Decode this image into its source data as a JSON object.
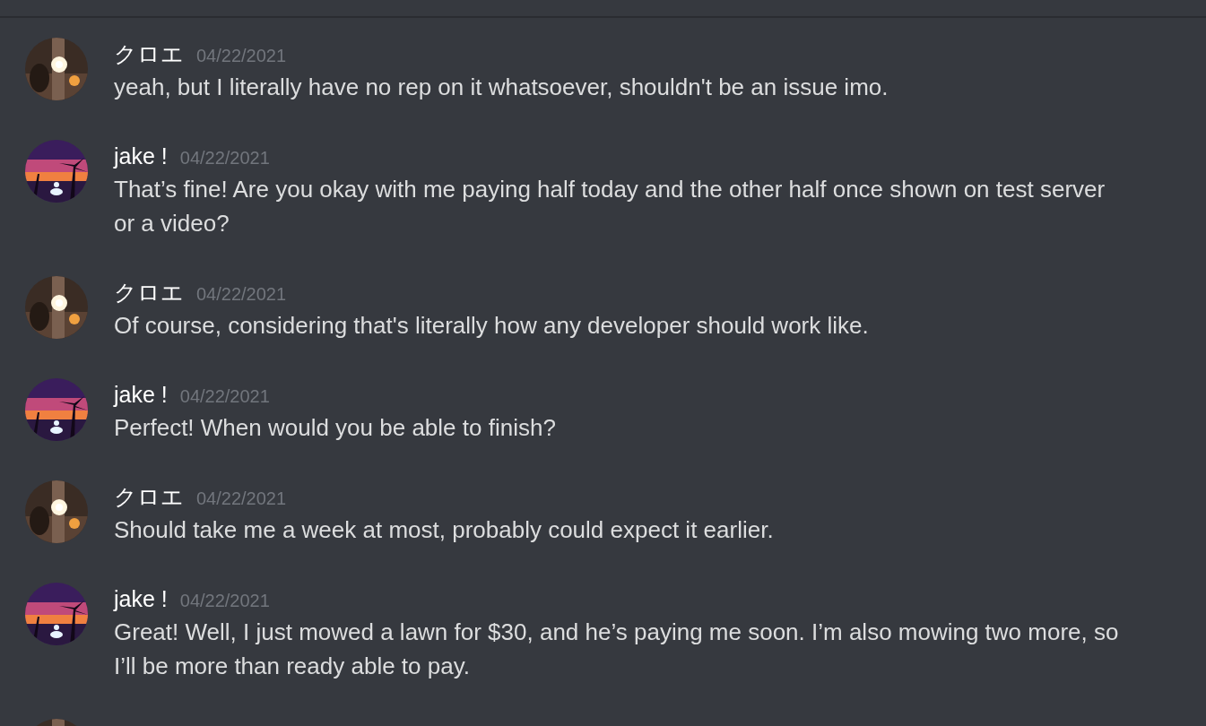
{
  "messages": [
    {
      "avatar": {
        "kind": "picture"
      },
      "author": "クロエ",
      "time": "04/22/2021",
      "text": "yeah, but I literally have no rep on it whatsoever, shouldn't be an issue imo."
    },
    {
      "avatar": {
        "kind": "picture"
      },
      "author": "jake !",
      "time": "04/22/2021",
      "text": "That’s fine! Are you okay with me paying half today and the other half once shown on test server or a video?"
    },
    {
      "avatar": {
        "kind": "picture"
      },
      "author": "クロエ",
      "time": "04/22/2021",
      "text": "Of course, considering that's literally how any developer should work like."
    },
    {
      "avatar": {
        "kind": "picture"
      },
      "author": "jake !",
      "time": "04/22/2021",
      "text": "Perfect! When would you be able to finish?"
    },
    {
      "avatar": {
        "kind": "picture"
      },
      "author": "クロエ",
      "time": "04/22/2021",
      "text": "Should take me a week at most, probably could expect it earlier."
    },
    {
      "avatar": {
        "kind": "picture"
      },
      "author": "jake !",
      "time": "04/22/2021",
      "text": "Great! Well, I just mowed a lawn for $30, and he’s paying me soon. I’m also mowing two more, so I’ll be more than ready able to pay."
    },
    {
      "avatar": {
        "kind": "picture"
      }
    }
  ]
}
